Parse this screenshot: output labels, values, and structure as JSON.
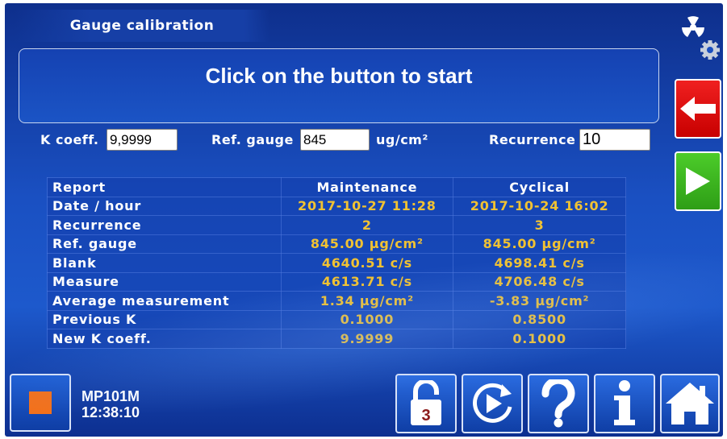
{
  "header": {
    "title": "Gauge calibration"
  },
  "message": "Click on the button to start",
  "fields": {
    "k_coeff": {
      "label": "K coeff.",
      "value": "9,9999"
    },
    "ref_gauge": {
      "label": "Ref. gauge",
      "value": "845",
      "unit": "ug/cm²"
    },
    "recurrence": {
      "label": "Recurrence",
      "value": "10"
    }
  },
  "report": {
    "columns": [
      "Report",
      "Maintenance",
      "Cyclical"
    ],
    "rows": [
      [
        "Date / hour",
        "2017-10-27 11:28",
        "2017-10-24 16:02"
      ],
      [
        "Recurrence",
        "2",
        "3"
      ],
      [
        "Ref. gauge",
        "845.00 μg/cm²",
        "845.00 μg/cm²"
      ],
      [
        "Blank",
        "4640.51 c/s",
        "4698.41 c/s"
      ],
      [
        "Measure",
        "4613.71 c/s",
        "4706.48 c/s"
      ],
      [
        "Average measurement",
        "1.34 μg/cm²",
        "-3.83 μg/cm²"
      ],
      [
        "Previous K",
        "0.1000",
        "0.8500"
      ],
      [
        "New K coeff.",
        "9.9999",
        "0.1000"
      ]
    ]
  },
  "status": {
    "device": "MP101M",
    "time": "12:38:10"
  },
  "toolbar": {
    "lock_badge": "3"
  },
  "icons": {
    "radiation_settings": "radiation-gear-icon",
    "back": "arrow-left-icon",
    "play": "play-icon",
    "stop": "stop-square-icon",
    "lock": "unlock-icon",
    "cycle": "cycle-play-icon",
    "help": "question-icon",
    "info": "info-icon",
    "home": "home-icon"
  },
  "colors": {
    "background": "#1a4fbf",
    "value_text": "#f1c232",
    "back_button": "#e01010",
    "play_button": "#3db31f",
    "stop_square": "#f2711c",
    "lock_badge": "#8b1a1a"
  }
}
